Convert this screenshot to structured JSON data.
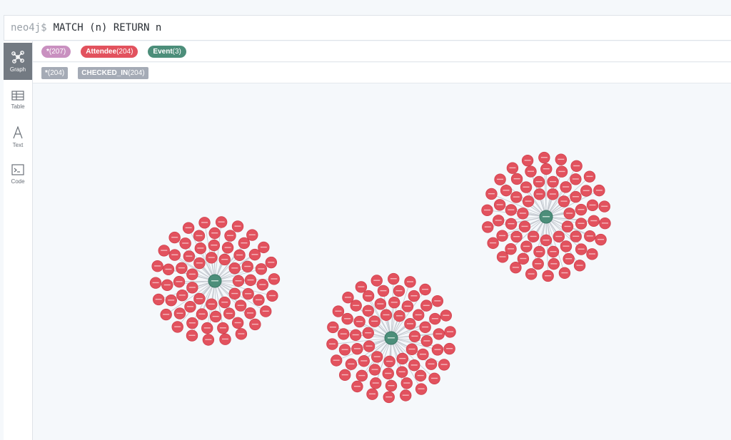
{
  "query": {
    "prompt": "neo4j$",
    "text": "MATCH (n) RETURN n"
  },
  "sidebar": {
    "items": [
      {
        "label": "Graph",
        "icon": "graph-icon",
        "active": true
      },
      {
        "label": "Table",
        "icon": "table-icon",
        "active": false
      },
      {
        "label": "Text",
        "icon": "text-icon",
        "active": false
      },
      {
        "label": "Code",
        "icon": "code-icon",
        "active": false
      }
    ]
  },
  "node_labels": [
    {
      "name": "*",
      "count": "(207)",
      "color": "#c990c0"
    },
    {
      "name": "Attendee",
      "count": "(204)",
      "color": "#e2525e"
    },
    {
      "name": "Event",
      "count": "(3)",
      "color": "#4c8e7a"
    }
  ],
  "relationship_types": [
    {
      "name": "*",
      "count": "(204)",
      "color": "#a5abb6"
    },
    {
      "name": "CHECKED_IN",
      "count": "(204)",
      "color": "#a5abb6"
    }
  ],
  "graph": {
    "attendee_color": "#e2525e",
    "event_color": "#4c8e7a",
    "edge_color": "#c4c9d0",
    "clusters": [
      {
        "event_id": "event-1",
        "attendees": 68
      },
      {
        "event_id": "event-2",
        "attendees": 68
      },
      {
        "event_id": "event-3",
        "attendees": 68
      }
    ]
  }
}
